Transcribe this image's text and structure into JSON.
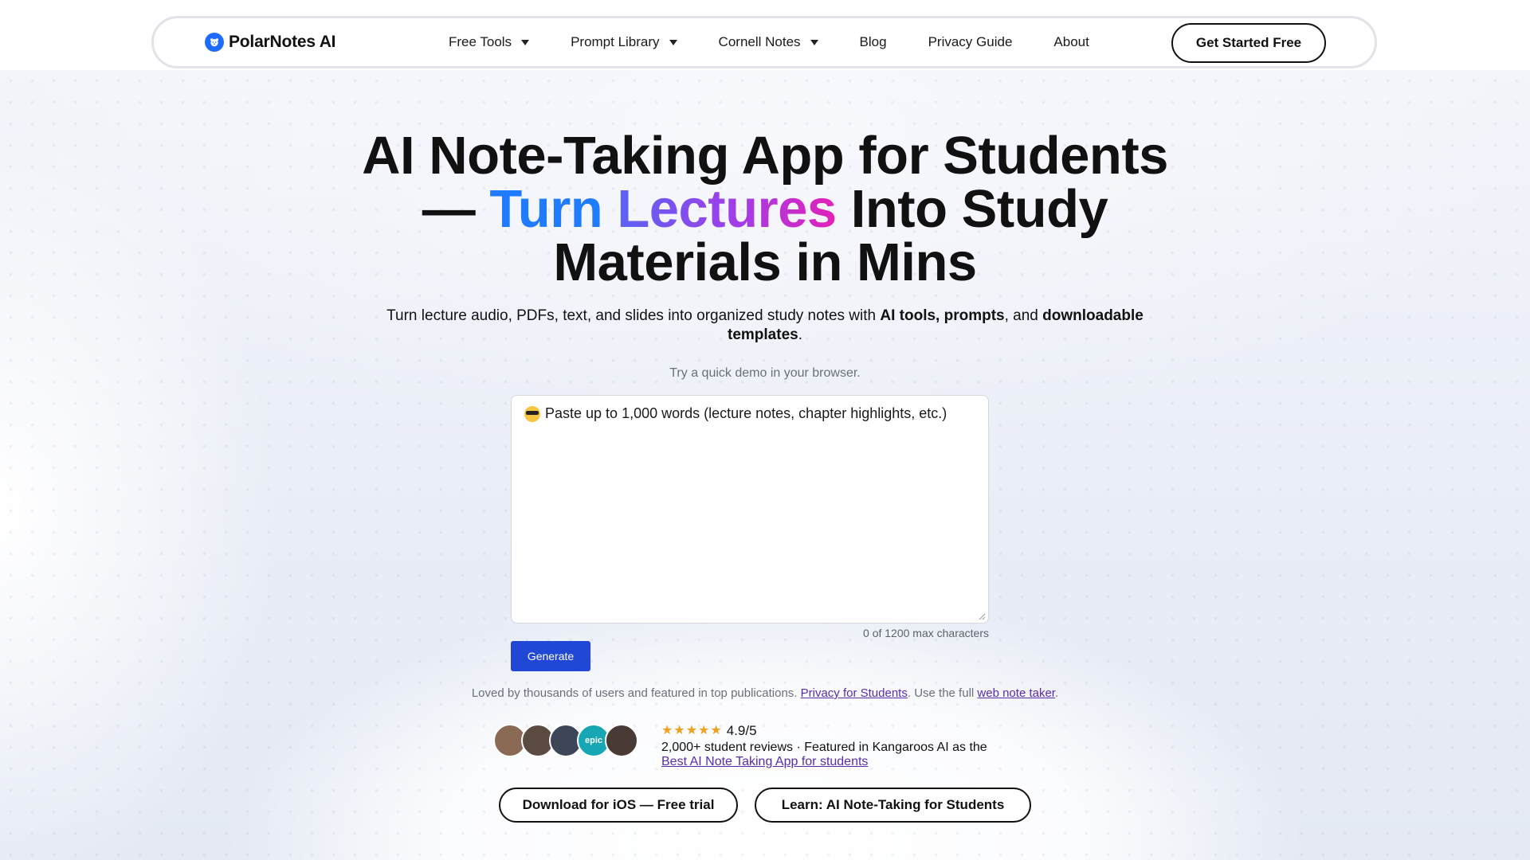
{
  "nav": {
    "logo_text": "PolarNotes AI",
    "items": [
      {
        "label": "Free Tools",
        "dropdown": true
      },
      {
        "label": "Prompt Library",
        "dropdown": true
      },
      {
        "label": "Cornell Notes",
        "dropdown": true
      },
      {
        "label": "Blog",
        "dropdown": false
      },
      {
        "label": "Privacy Guide",
        "dropdown": false
      },
      {
        "label": "About",
        "dropdown": false
      }
    ],
    "cta_label": "Get Started Free"
  },
  "hero": {
    "title_line1": "AI Note-Taking App for Students",
    "title_line2_prefix": "— ",
    "title_line2_word1": "Turn",
    "title_line2_word2": "Lectures",
    "title_line2_suffix": " Into Study",
    "title_line3": "Materials in Mins",
    "subtitle_part1": "Turn lecture audio, PDFs, text, and slides into organized study notes with ",
    "subtitle_bold1": "AI tools, prompts",
    "subtitle_part2": ", and ",
    "subtitle_bold2": "downloadable templates",
    "subtitle_part3": "."
  },
  "demo": {
    "hint": "Try a quick demo in your browser.",
    "placeholder": "Paste up to 1,000 words (lecture notes, chapter highlights, etc.)",
    "char_count": "0 of 1200 max characters",
    "generate_label": "Generate"
  },
  "loved": {
    "text1": "Loved by thousands of users and featured in top publications. ",
    "link1": "Privacy for Students",
    "text2": ". Use the full ",
    "link2": "web note taker",
    "text3": "."
  },
  "social": {
    "avatars": [
      {
        "name": "avatar-1",
        "color": "#8a6a55",
        "label": ""
      },
      {
        "name": "avatar-2",
        "color": "#5b4a42",
        "label": ""
      },
      {
        "name": "avatar-3",
        "color": "#3d4656",
        "label": ""
      },
      {
        "name": "avatar-4",
        "color": "#17a7b4",
        "label": "epic"
      },
      {
        "name": "avatar-5",
        "color": "#4a3a36",
        "label": ""
      }
    ],
    "stars": 5,
    "rating": "4.9/5",
    "reviews_text": "2,000+ student reviews · Featured in Kangaroos AI as the",
    "reviews_link": "Best AI Note Taking App for students"
  },
  "buttons": {
    "ios_label": "Download for iOS — Free trial",
    "learn_label": "Learn: AI Note-Taking for Students"
  },
  "colors": {
    "brand_blue": "#1f6bff",
    "generate_blue": "#2147d6",
    "link_purple": "#5a2bb0",
    "star_gold": "#f0a020"
  }
}
